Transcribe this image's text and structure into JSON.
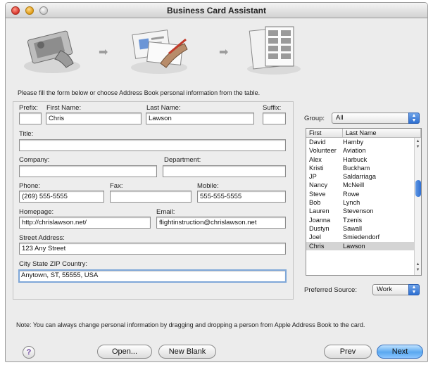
{
  "window": {
    "title": "Business Card Assistant"
  },
  "banner": {
    "steps": [
      {
        "icon": "card-scan-icon"
      },
      {
        "icon": "card-edit-icon"
      },
      {
        "icon": "card-sheet-icon"
      }
    ],
    "arrow_icon": "arrow-right-icon"
  },
  "instruction": "Please fill the form below or choose Address Book personal information from the table.",
  "form": {
    "prefix_label": "Prefix:",
    "prefix_value": "",
    "first_name_label": "First Name:",
    "first_name_value": "Chris",
    "last_name_label": "Last Name:",
    "last_name_value": "Lawson",
    "suffix_label": "Suffix:",
    "suffix_value": "",
    "title_label": "Title:",
    "title_value": "",
    "company_label": "Company:",
    "company_value": "",
    "department_label": "Department:",
    "department_value": "",
    "phone_label": "Phone:",
    "phone_value": "(269) 555-5555",
    "fax_label": "Fax:",
    "fax_value": "",
    "mobile_label": "Mobile:",
    "mobile_value": "555-555-5555",
    "homepage_label": "Homepage:",
    "homepage_value": "http://chrislawson.net/",
    "email_label": "Email:",
    "email_value": "flightinstruction@chrislawson.net",
    "street_label": "Street Address:",
    "street_value": "123 Any Street",
    "city_label": "City State ZIP Country:",
    "city_value": "Anytown, ST, 55555, USA"
  },
  "contacts": {
    "group_label": "Group:",
    "group_value": "All",
    "columns": [
      "First",
      "Last Name"
    ],
    "rows": [
      {
        "first": "David",
        "last": "Hamby"
      },
      {
        "first": "Volunteer",
        "last": "Aviation"
      },
      {
        "first": "Alex",
        "last": "Harbuck"
      },
      {
        "first": "Kristi",
        "last": "Buckham"
      },
      {
        "first": "JP",
        "last": "Saldarriaga"
      },
      {
        "first": "Nancy",
        "last": "McNeill"
      },
      {
        "first": "Steve",
        "last": "Rowe"
      },
      {
        "first": "Bob",
        "last": "Lynch"
      },
      {
        "first": "Lauren",
        "last": "Stevenson"
      },
      {
        "first": "Joanna",
        "last": "Tzenis"
      },
      {
        "first": "Dustyn",
        "last": "Sawall"
      },
      {
        "first": "Joel",
        "last": "Smiedendorf"
      },
      {
        "first": "Chris",
        "last": "Lawson"
      }
    ],
    "selected_index": 12,
    "preferred_source_label": "Preferred Source:",
    "preferred_source_value": "Work"
  },
  "note": "Note: You can always change personal information by dragging and dropping a person from Apple Address Book to the card.",
  "buttons": {
    "help": "?",
    "open": "Open...",
    "new_blank": "New Blank",
    "prev": "Prev",
    "next": "Next"
  },
  "colors": {
    "accent": "#5aa8f0",
    "selection": "#d4d4d4"
  }
}
